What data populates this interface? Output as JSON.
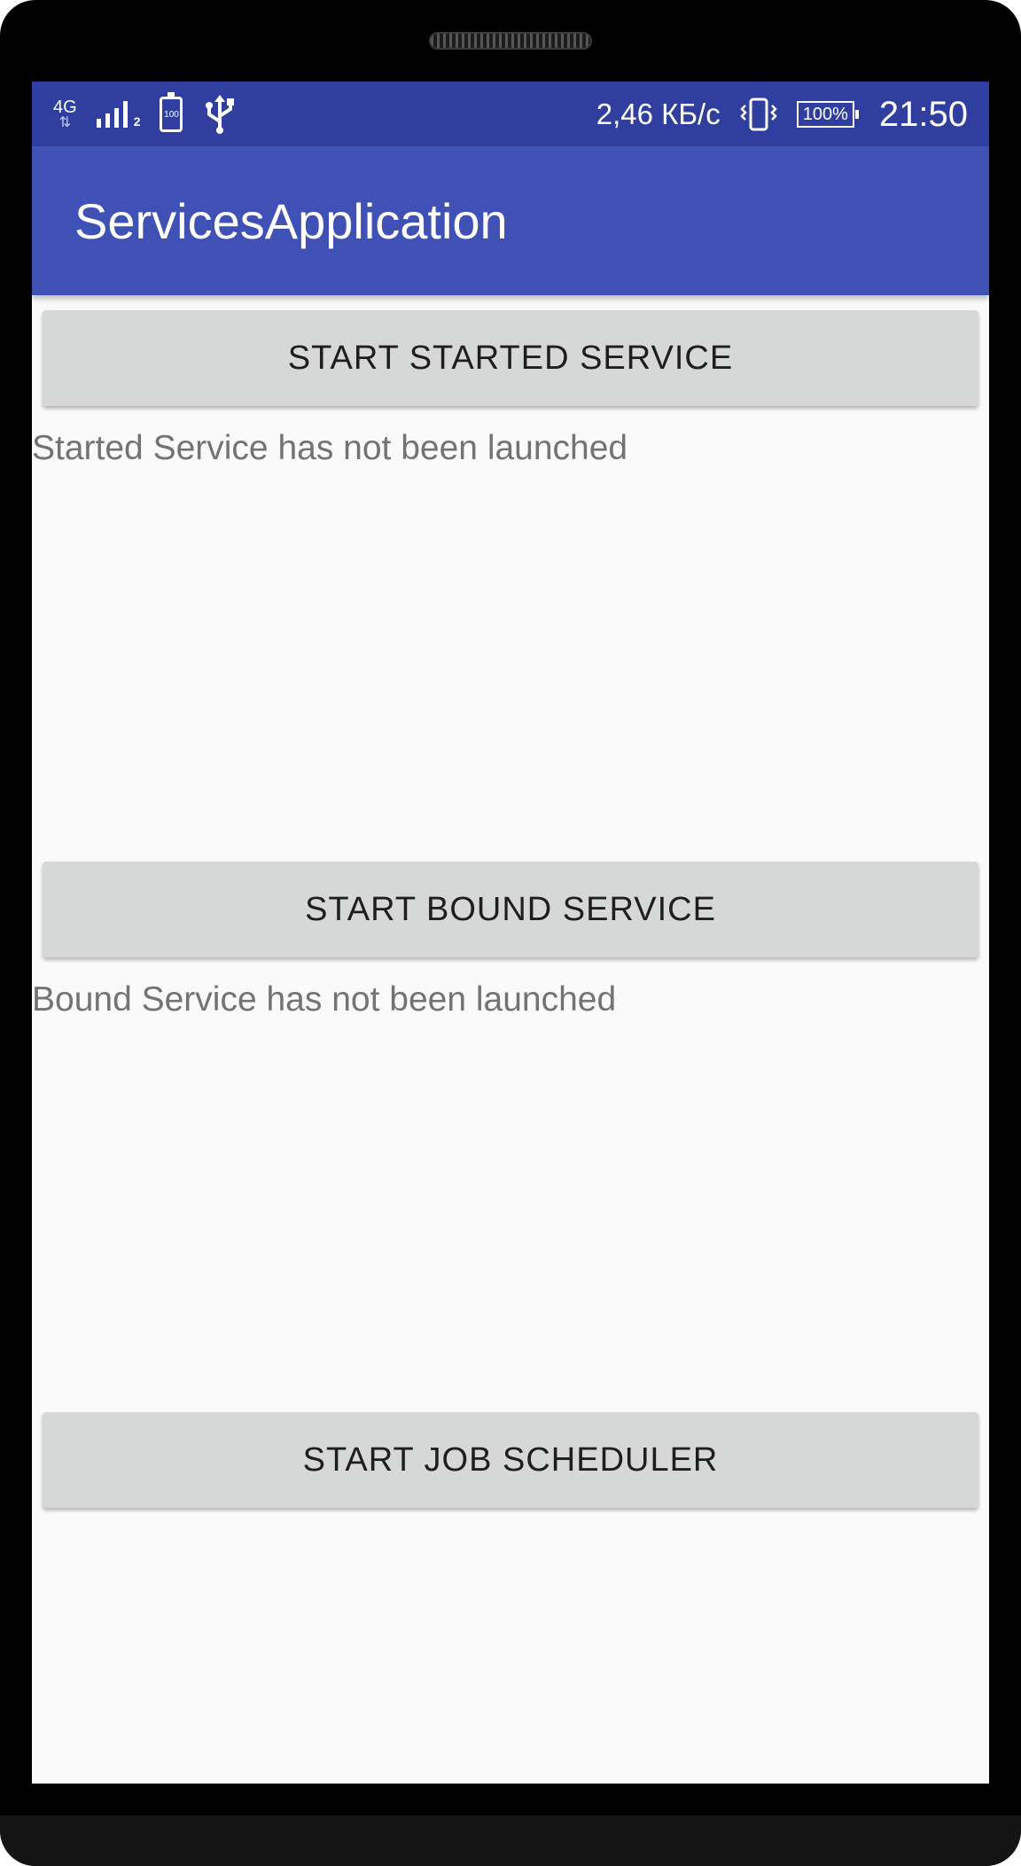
{
  "status_bar": {
    "network_type": "4G",
    "signal_sub": "2",
    "battery_icon_text": "100",
    "speed": "2,46 КБ/с",
    "battery_percent": "100%",
    "time": "21:50",
    "icons": [
      "network-4g-icon",
      "signal-icon",
      "battery-saver-icon",
      "usb-icon",
      "vibrate-icon",
      "battery-icon"
    ]
  },
  "app_bar": {
    "title": "ServicesApplication",
    "color": "#3f51b5",
    "status_color": "#303f9f"
  },
  "main": {
    "started_service_button": "START STARTED SERVICE",
    "started_service_status": "Started Service has not been launched",
    "bound_service_button": "START BOUND SERVICE",
    "bound_service_status": "Bound Service has not been launched",
    "job_scheduler_button": "START JOB SCHEDULER"
  }
}
